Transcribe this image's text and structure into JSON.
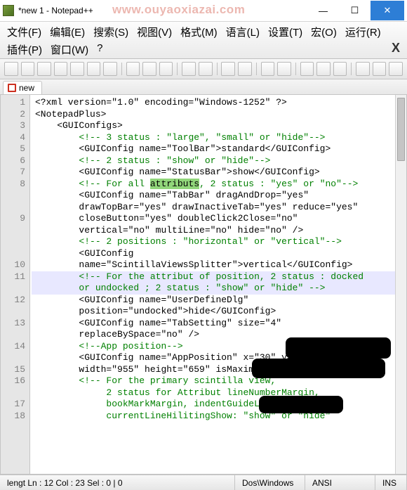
{
  "title": "*new  1 - Notepad++",
  "watermark": "www.ouyaoxiazai.com",
  "menus": {
    "file": "文件(F)",
    "edit": "编辑(E)",
    "search": "搜索(S)",
    "view": "视图(V)",
    "format": "格式(M)",
    "language": "语言(L)",
    "settings": "设置(T)",
    "macro": "宏(O)",
    "run": "运行(R)",
    "plugins": "插件(P)",
    "window": "窗口(W)",
    "help": "?"
  },
  "tab": {
    "name": "new "
  },
  "gutter": [
    "1",
    "2",
    "3",
    "4",
    "5",
    "6",
    "7",
    "8",
    "",
    "",
    "9",
    "",
    "",
    "",
    "10",
    "11",
    "",
    "12",
    "",
    "13",
    "",
    "14",
    "",
    "15",
    "16",
    "",
    "17",
    "18",
    "",
    ""
  ],
  "lines": [
    {
      "t": "<?xml version=\"1.0\" encoding=\"Windows-1252\" ?>"
    },
    {
      "t": "<NotepadPlus>"
    },
    {
      "t": "    <GUIConfigs>"
    },
    {
      "t": "        <!-- 3 status : \"large\", \"small\" or \"hide\"-->",
      "c": true
    },
    {
      "t": "        <GUIConfig name=\"ToolBar\">standard</GUIConfig>"
    },
    {
      "t": "        <!-- 2 status : \"show\" or \"hide\"-->",
      "c": true
    },
    {
      "t": "        <GUIConfig name=\"StatusBar\">show</GUIConfig>"
    },
    {
      "t": "        <!-- For all |attributs|, 2 status : \"yes\" or \"no\"-->",
      "c": true,
      "hw": "attributs"
    },
    {
      "t": "        <GUIConfig name=\"TabBar\" dragAndDrop=\"yes\" "
    },
    {
      "t": "        drawTopBar=\"yes\" drawInactiveTab=\"yes\" reduce=\"yes\" "
    },
    {
      "t": "        closeButton=\"yes\" doubleClick2Close=\"no\" "
    },
    {
      "t": "        vertical=\"no\" multiLine=\"no\" hide=\"no\" />"
    },
    {
      "t": "        <!-- 2 positions : \"horizontal\" or \"vertical\"-->",
      "c": true
    },
    {
      "t": "        <GUIConfig "
    },
    {
      "t": "        name=\"ScintillaViewsSplitter\">vertical</GUIConfig>"
    },
    {
      "t": "        <!-- For the a|ttribut of position, 2 status : docked ",
      "c": true,
      "hl": true
    },
    {
      "t": "        or undocked ; 2 status : \"show\" or \"hide\" -->",
      "c": true,
      "hl": true
    },
    {
      "t": "        <GUIConfig name=\"UserDefineDlg\" "
    },
    {
      "t": "        position=\"undocked\">hide</GUIConfig>"
    },
    {
      "t": "        <GUIConfig name=\"TabSetting\" size=\"4\" "
    },
    {
      "t": "        replaceBySpace=\"no\" />"
    },
    {
      "t": "        <!--App position-->",
      "c": true
    },
    {
      "t": "        <GUIConfig name=\"AppPosition\" x=\"30\" y=\"27\" "
    },
    {
      "t": "        width=\"955\" height=\"659\" isMaximized=\"no\" />"
    },
    {
      "t": "        <!-- For the primary scintilla view,",
      "c": true
    },
    {
      "t": "             2 status for Attribut lineNumberMargin, ",
      "c": true
    },
    {
      "t": "             bookMarkMargin, indentGuideLine and ",
      "c": true
    },
    {
      "t": "             currentLineHilitingShow: \"show\" or \"hide\"",
      "c": true
    }
  ],
  "status": {
    "pos": "lengt Ln : 12    Col : 23    Sel : 0 | 0",
    "eol": "Dos\\Windows",
    "enc": "ANSI",
    "mode": "INS"
  }
}
